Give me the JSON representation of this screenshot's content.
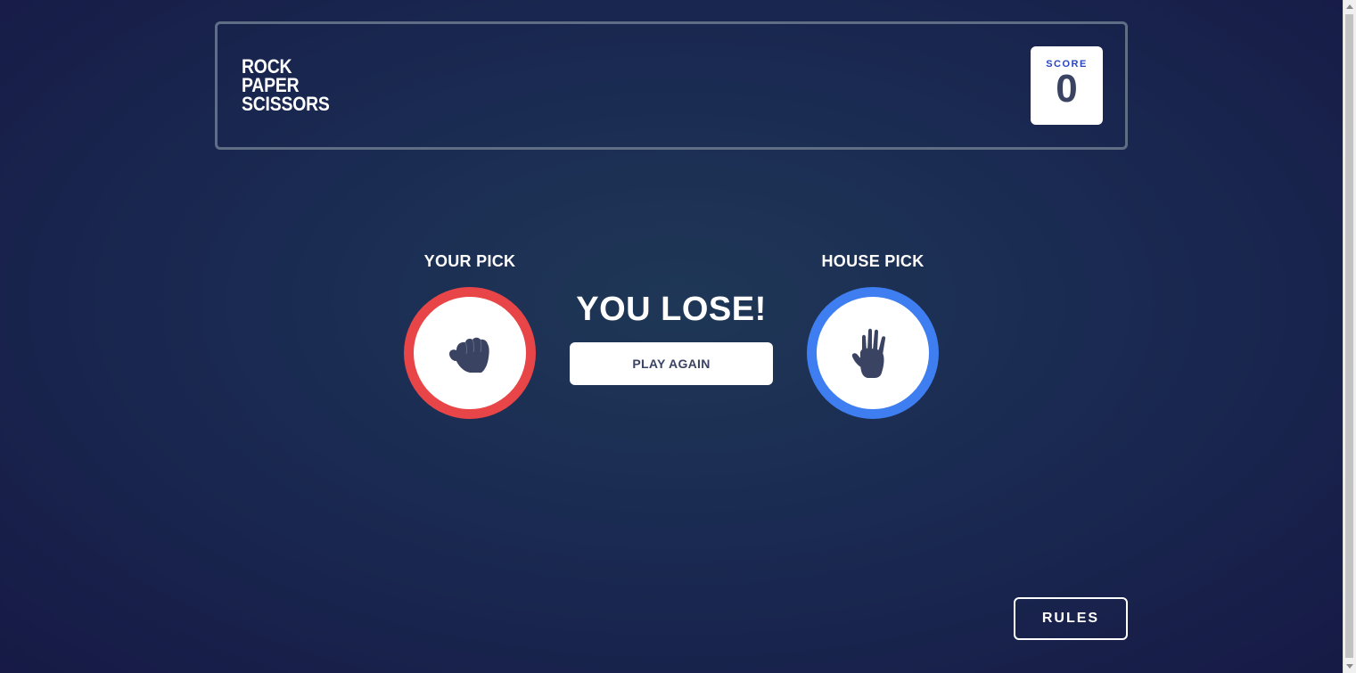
{
  "header": {
    "logo_lines": [
      "ROCK",
      "PAPER",
      "SCISSORS"
    ],
    "score_label": "SCORE",
    "score_value": "0"
  },
  "game": {
    "your_pick_label": "YOUR PICK",
    "house_pick_label": "HOUSE PICK",
    "your_pick_icon": "rock-fist-icon",
    "house_pick_icon": "paper-hand-icon",
    "result_text": "YOU LOSE!",
    "play_again_label": "PLAY AGAIN"
  },
  "footer": {
    "rules_label": "RULES"
  },
  "colors": {
    "rock_ring": "#e84548",
    "paper_ring": "#3f7ef0",
    "icon_fill": "#3b4363",
    "score_label": "#2a46c0",
    "header_border": "#606e85"
  }
}
